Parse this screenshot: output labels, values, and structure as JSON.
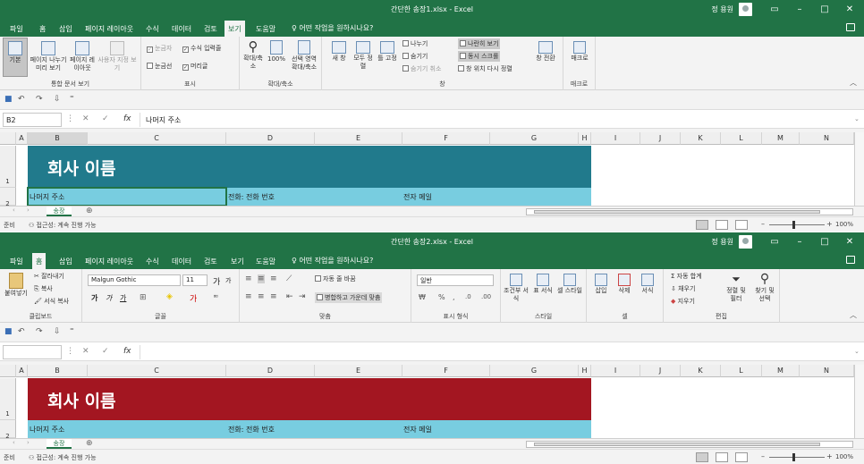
{
  "win1": {
    "title": "간단한 송장1.xlsx  -  Excel",
    "user": "정 용원",
    "tabs": [
      "파일",
      "홈",
      "삽입",
      "페이지 레이아웃",
      "수식",
      "데이터",
      "검토",
      "보기",
      "도움말"
    ],
    "tellme": "어떤 작업을 원하시나요?",
    "ribbon": {
      "normal": "기본",
      "pagebreak": "페이지 나누기 미리 보기",
      "pagelayout": "페이지 레이아웃",
      "custom": "사용자 지정 보기",
      "g1": "통합 문서 보기",
      "ruler": "눈금자",
      "formulabar": "수식 입력줄",
      "gridlines": "눈금선",
      "headings": "머리글",
      "g2": "표시",
      "zoom": "확대/축소",
      "zoom100": "100%",
      "zoomsel": "선택 영역 확대/축소",
      "g3": "확대/축소",
      "newwin": "새 창",
      "arrange": "모두 정렬",
      "freeze": "틀 고정",
      "split": "나누기",
      "hide": "숨기기",
      "unhide": "숨기기 취소",
      "sidebyside": "나란히 보기",
      "syncscroll": "동시 스크롤",
      "resetpos": "창 위치 다시 정렬",
      "switchwin": "창 전환",
      "g4": "창",
      "macro": "매크로",
      "g5": "매크로"
    },
    "namebox": "B2",
    "formula": "나머지 주소",
    "banner_color": "#217a8c",
    "banner_text": "회사 이름"
  },
  "win2": {
    "title": "간단한 송장2.xlsx  -  Excel",
    "user": "정 용원",
    "tabs": [
      "파일",
      "홈",
      "삽입",
      "페이지 레이아웃",
      "수식",
      "데이터",
      "검토",
      "보기",
      "도움말"
    ],
    "tellme": "어떤 작업을 원하시나요?",
    "ribbon": {
      "paste": "붙여넣기",
      "cut": "잘라내기",
      "copy": "복사",
      "painter": "서식 복사",
      "g1": "클립보드",
      "font": "Malgun Gothic",
      "size": "11",
      "bold": "가",
      "italic": "가",
      "underline": "가",
      "g2": "글꼴",
      "wrap": "자동 줄 바꿈",
      "merge": "병합하고 가운데 맞춤",
      "g3": "맞춤",
      "numfmt": "일반",
      "g4": "표시 형식",
      "condfmt": "조건부 서식",
      "tablefmt": "표 서식",
      "cellstyle": "셀 스타일",
      "g5": "스타일",
      "insert": "삽입",
      "delete": "삭제",
      "format": "서식",
      "g6": "셀",
      "autosum": "자동 합계",
      "fill": "채우기",
      "clear": "지우기",
      "sort": "정렬 및 필터",
      "find": "찾기 및 선택",
      "g7": "편집"
    },
    "namebox": "",
    "formula": "",
    "banner_color": "#a31621",
    "banner_text": "회사 이름"
  },
  "shared": {
    "columns": [
      "A",
      "B",
      "C",
      "D",
      "E",
      "F",
      "G",
      "H",
      "I",
      "J",
      "K",
      "L",
      "M",
      "N"
    ],
    "rows": [
      "1",
      "2"
    ],
    "addr": "나머지 주소",
    "phone": "전화: 전화 번호",
    "email": "전자 메일",
    "sheet": "송장",
    "ready": "준비",
    "access": "접근성: 계속 진행 가능",
    "zoom": "100%"
  }
}
